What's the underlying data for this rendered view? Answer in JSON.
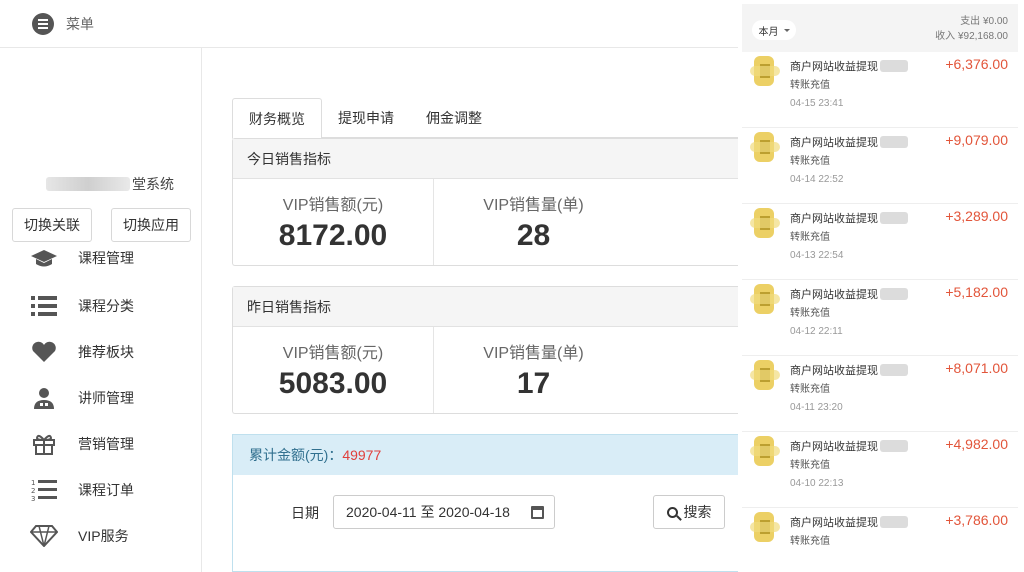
{
  "topbar": {
    "menu_label": "菜单"
  },
  "sidebar": {
    "system_name": "堂系统",
    "switch_link_label": "切换关联",
    "switch_app_label": "切换应用",
    "items": [
      {
        "label": "课程管理",
        "icon": "graduation-cap-icon"
      },
      {
        "label": "课程分类",
        "icon": "list-icon"
      },
      {
        "label": "推荐板块",
        "icon": "heart-icon"
      },
      {
        "label": "讲师管理",
        "icon": "user-tie-icon"
      },
      {
        "label": "营销管理",
        "icon": "gift-icon"
      },
      {
        "label": "课程订单",
        "icon": "ordered-list-icon"
      },
      {
        "label": "VIP服务",
        "icon": "diamond-icon"
      }
    ]
  },
  "tabs": [
    {
      "label": "财务概览",
      "active": true
    },
    {
      "label": "提现申请",
      "active": false
    },
    {
      "label": "佣金调整",
      "active": false
    }
  ],
  "today": {
    "title": "今日销售指标",
    "amount_label": "VIP销售额(元)",
    "amount_value": "8172.00",
    "count_label": "VIP销售量(单)",
    "count_value": "28"
  },
  "yesterday": {
    "title": "昨日销售指标",
    "amount_label": "VIP销售额(元)",
    "amount_value": "5083.00",
    "count_label": "VIP销售量(单)",
    "count_value": "17"
  },
  "total": {
    "label": "累计金额(元)：",
    "value": "49977"
  },
  "search": {
    "date_label": "日期",
    "date_range": "2020-04-11 至 2020-04-18",
    "button_label": "搜索"
  },
  "phone": {
    "month_label": "本月",
    "expense": "支出 ¥0.00",
    "income": "收入 ¥92,168.00",
    "transactions": [
      {
        "title": "商户网站收益提现",
        "type": "转账充值",
        "date": "04-15  23:41",
        "amount": "+6,376.00"
      },
      {
        "title": "商户网站收益提现",
        "type": "转账充值",
        "date": "04-14  22:52",
        "amount": "+9,079.00"
      },
      {
        "title": "商户网站收益提现",
        "type": "转账充值",
        "date": "04-13  22:54",
        "amount": "+3,289.00"
      },
      {
        "title": "商户网站收益提现",
        "type": "转账充值",
        "date": "04-12  22:11",
        "amount": "+5,182.00"
      },
      {
        "title": "商户网站收益提现",
        "type": "转账充值",
        "date": "04-11  23:20",
        "amount": "+8,071.00"
      },
      {
        "title": "商户网站收益提现",
        "type": "转账充值",
        "date": "04-10  22:13",
        "amount": "+4,982.00"
      },
      {
        "title": "商户网站收益提现",
        "type": "转账充值",
        "date": "",
        "amount": "+3,786.00"
      }
    ]
  },
  "colors": {
    "accent_red": "#e2553a",
    "info_bg": "#d9edf7",
    "info_text": "#31708f"
  }
}
